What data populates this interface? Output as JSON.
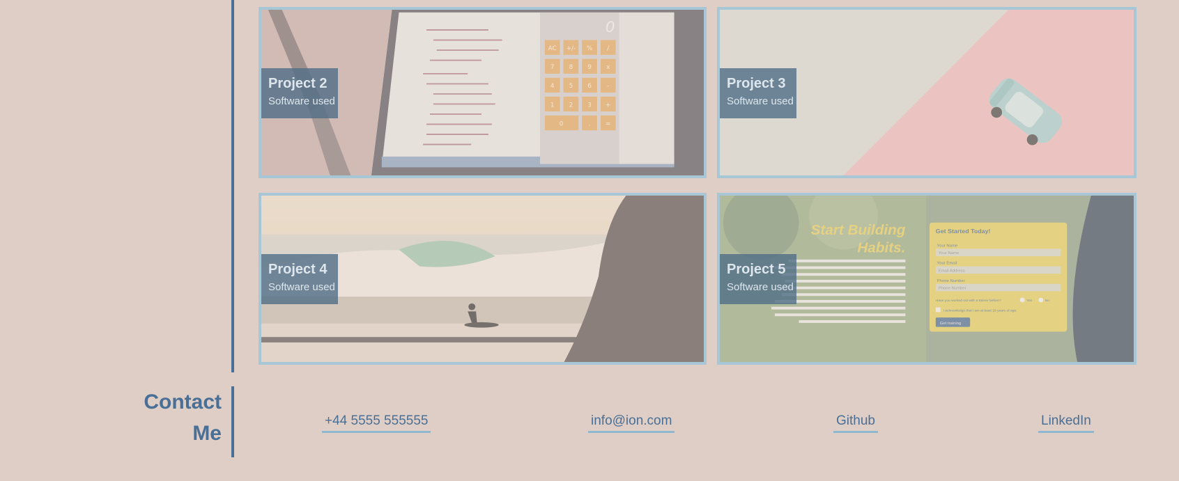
{
  "projects": [
    {
      "title": "Project 2",
      "subtitle": "Software used"
    },
    {
      "title": "Project 3",
      "subtitle": "Software used"
    },
    {
      "title": "Project 4",
      "subtitle": "Software used"
    },
    {
      "title": "Project 5",
      "subtitle": "Software used"
    }
  ],
  "project5_screenshot": {
    "headline_1": "Start Building",
    "headline_2": "Habits.",
    "form_title": "Get Started Today!",
    "name_label": "Your Name",
    "name_placeholder": "Your Name",
    "email_label": "Your Email",
    "email_placeholder": "Email Address",
    "phone_label": "Phone Number",
    "phone_placeholder": "Phone Number",
    "trainer_question": "Have you worked out with a trainer before?",
    "yes": "Yes",
    "no": "No",
    "consent": "I acknowledge that I am at least 18 years of age.",
    "submit": "Get training"
  },
  "project2_screenshot": {
    "calc_display": "0",
    "keys": [
      "AC",
      "+/-",
      "%",
      "/",
      "7",
      "8",
      "9",
      "x",
      "4",
      "5",
      "6",
      "-",
      "1",
      "2",
      "3",
      "+",
      "0",
      ".",
      "="
    ]
  },
  "contact": {
    "title_line_1": "Contact",
    "title_line_2": "Me",
    "phone": "+44 5555 555555",
    "email": "info@ion.com",
    "github": "Github",
    "linkedin": "LinkedIn"
  },
  "colors": {
    "background": "#dfcec5",
    "accent": "#4a6f96",
    "card_border": "#a8c7d6",
    "link_underline": "#8fb7ce"
  }
}
